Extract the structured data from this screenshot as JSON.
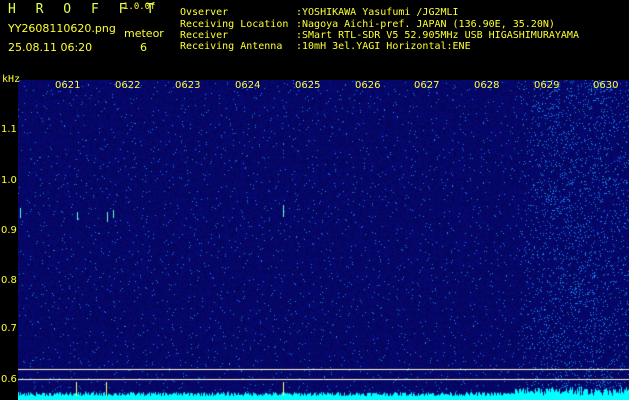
{
  "header": {
    "logo": "H R O F F T",
    "version": "1.0.0f",
    "filename": "YY2608110620.png",
    "datetime": "25.08.11 06:20",
    "meteor_label": "meteor",
    "meteor_count": "6"
  },
  "meta": [
    {
      "label": "Ovserver",
      "value": ":YOSHIKAWA Yasufumi /JG2MLI"
    },
    {
      "label": "Receiving Location",
      "value": ":Nagoya Aichi-pref. JAPAN (136.90E, 35.20N)"
    },
    {
      "label": "Receiver",
      "value": ":SMart RTL-SDR V5 52.905MHz USB HIGASHIMURAYAMA"
    },
    {
      "label": "Receiving Antenna",
      "value": ":10mH 3el.YAGI Horizontal:ENE"
    }
  ],
  "axis": {
    "unit": "kHz",
    "y_ticks": [
      "1.1",
      "1.0",
      "0.9",
      "0.8",
      "0.7",
      "0.6"
    ],
    "x_ticks": [
      "0621",
      "0622",
      "0623",
      "0624",
      "0625",
      "0626",
      "0627",
      "0628",
      "0629",
      "0630"
    ]
  },
  "colors": {
    "background": "#000000",
    "waterfall": "#0a0a6e",
    "label": "#ffff33",
    "trace": "#00ffff"
  }
}
